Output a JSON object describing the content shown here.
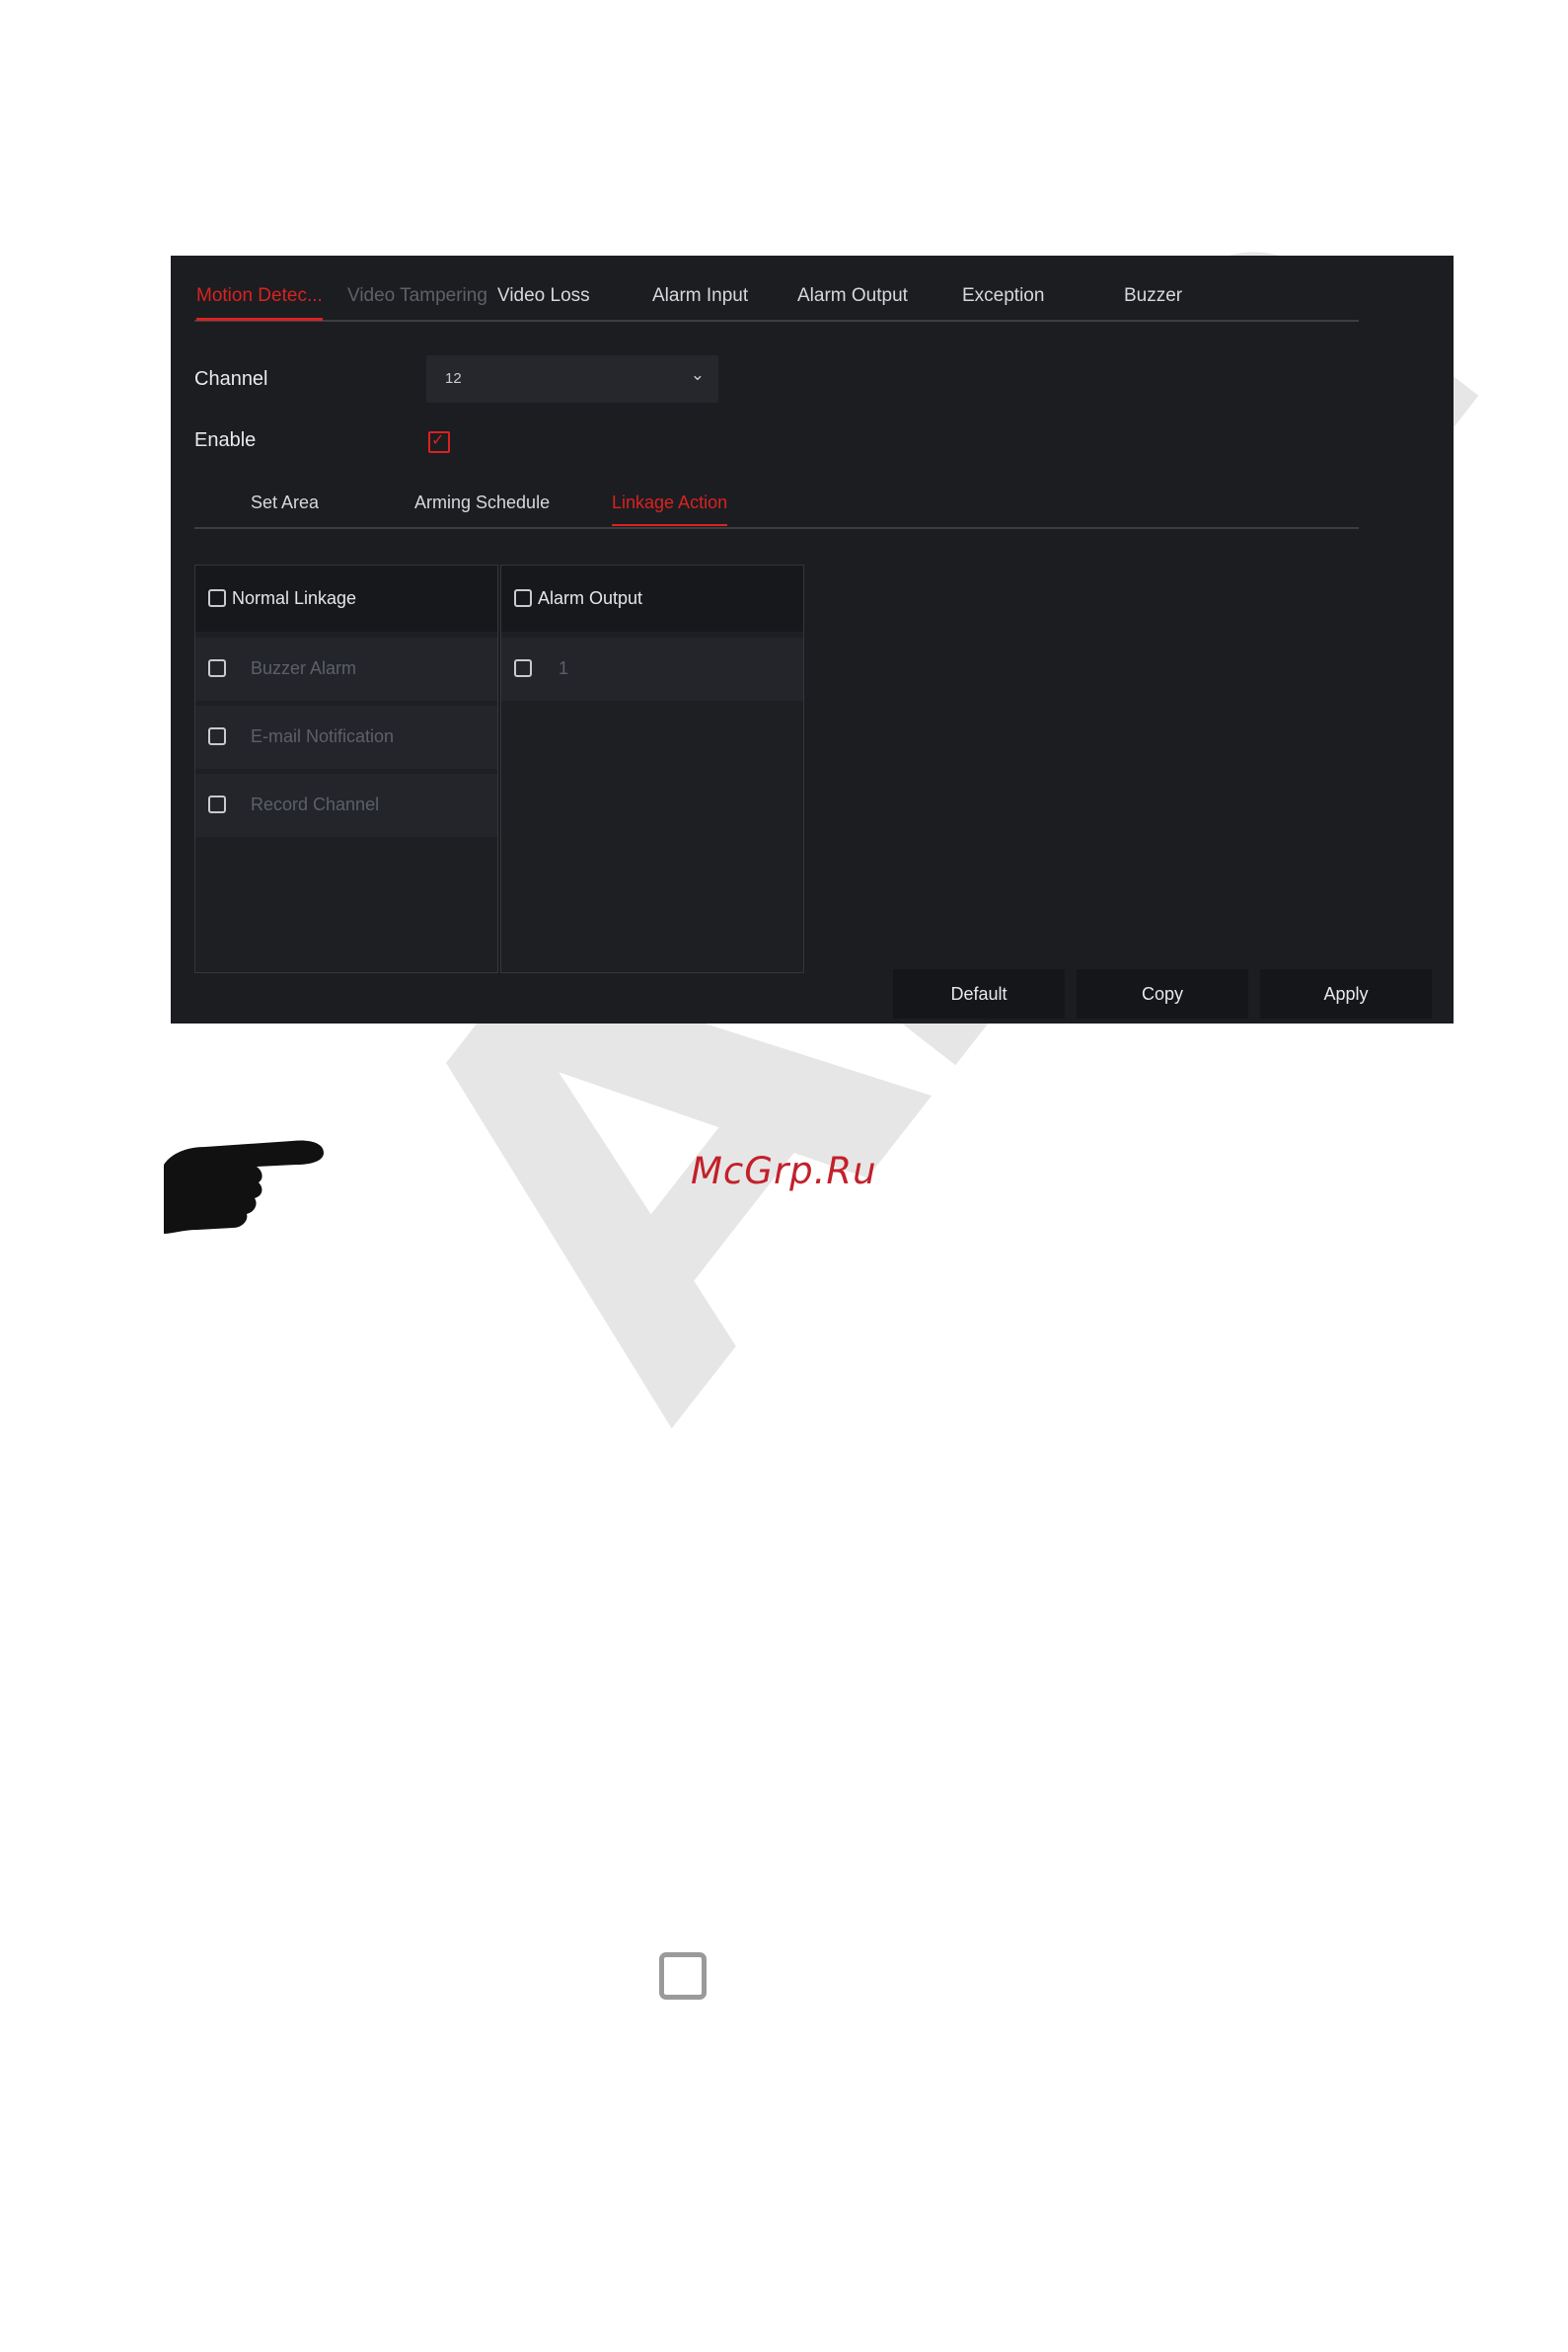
{
  "watermark": "Ama",
  "main_tabs": [
    {
      "label": "Motion Detec...",
      "state": "active"
    },
    {
      "label": "Video Tampering",
      "state": "disabled"
    },
    {
      "label": "Video Loss",
      "state": "normal"
    },
    {
      "label": "Alarm Input",
      "state": "normal"
    },
    {
      "label": "Alarm Output",
      "state": "normal"
    },
    {
      "label": "Exception",
      "state": "normal"
    },
    {
      "label": "Buzzer",
      "state": "normal"
    }
  ],
  "channel": {
    "label": "Channel",
    "value": "12"
  },
  "enable": {
    "label": "Enable",
    "checked": true
  },
  "sub_tabs": [
    {
      "label": "Set Area"
    },
    {
      "label": "Arming Schedule"
    },
    {
      "label": "Linkage Action",
      "active": true
    }
  ],
  "normal_linkage": {
    "header": "Normal Linkage",
    "items": [
      "Buzzer Alarm",
      "E-mail Notification",
      "Record Channel"
    ]
  },
  "alarm_output": {
    "header": "Alarm Output",
    "items": [
      "1"
    ]
  },
  "buttons": {
    "default": "Default",
    "copy": "Copy",
    "apply": "Apply"
  },
  "site_label": "McGrp.Ru",
  "colors": {
    "accent": "#d92222",
    "panel_bg": "#1c1d20",
    "site_label": "#c3202a"
  },
  "icons": {
    "pointer": "pointing-hand-icon",
    "checkbox": "checkbox-outline-icon"
  }
}
